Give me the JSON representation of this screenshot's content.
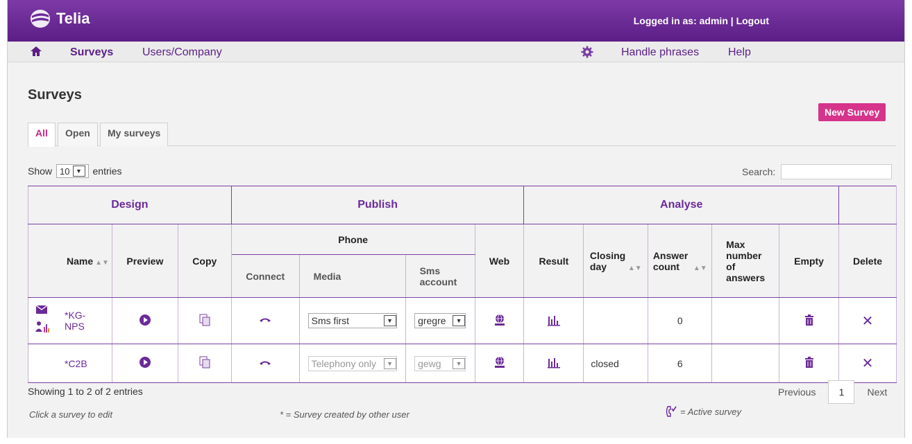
{
  "header": {
    "brand": "Telia",
    "login_text": "Logged in as: admin |",
    "logout": "Logout"
  },
  "nav": {
    "surveys": "Surveys",
    "users_company": "Users/Company",
    "handle_phrases": "Handle phrases",
    "help": "Help"
  },
  "page": {
    "title": "Surveys",
    "new_survey": "New Survey"
  },
  "tabs": [
    "All",
    "Open",
    "My surveys"
  ],
  "controls": {
    "show": "Show",
    "show_value": "10",
    "entries": "entries",
    "search_label": "Search:"
  },
  "table": {
    "groups": {
      "design": "Design",
      "publish": "Publish",
      "analyse": "Analyse"
    },
    "headers": {
      "name": "Name",
      "preview": "Preview",
      "copy": "Copy",
      "phone": "Phone",
      "connect": "Connect",
      "media": "Media",
      "sms_account": "Sms account",
      "web": "Web",
      "result": "Result",
      "closing_day": "Closing day",
      "answer_count": "Answer count",
      "max_answers": "Max number of answers",
      "empty": "Empty",
      "delete": "Delete"
    },
    "rows": [
      {
        "name": "*KG-NPS",
        "media": "Sms first",
        "sms_account": "gregre",
        "closing_day": "",
        "answer_count": "0",
        "max_answers": ""
      },
      {
        "name": "*C2B",
        "media": "Telephony only",
        "sms_account": "gewg",
        "closing_day": "closed",
        "answer_count": "6",
        "max_answers": ""
      }
    ]
  },
  "footer": {
    "showing": "Showing 1 to 2 of 2 entries",
    "previous": "Previous",
    "page": "1",
    "next": "Next",
    "hint_edit": "Click a survey to edit",
    "hint_other": "* = Survey created by other user",
    "hint_active": "= Active survey"
  },
  "colors": {
    "brand_purple": "#5b1e86",
    "accent_pink": "#d6338a"
  }
}
